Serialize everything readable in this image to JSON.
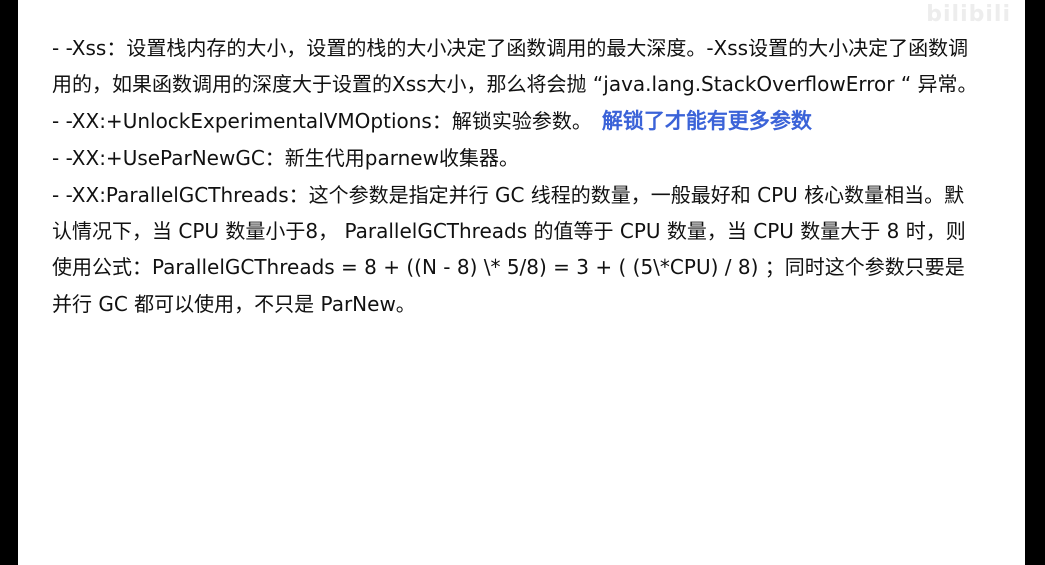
{
  "watermark": "bilibili",
  "paragraphs": [
    "- -Xss：设置栈内存的大小，设置的栈的大小决定了函数调用的最大深度。-Xss设置的大小决定了函数调用的，如果函数调用的深度大于设置的Xss大小，那么将会抛 “java.lang.StackOverflowError “ 异常。",
    "- -XX:+UnlockExperimentalVMOptions：解锁实验参数。",
    "- -XX:+UseParNewGC：新生代用parnew收集器。",
    "- -XX:ParallelGCThreads：这个参数是指定并行 GC 线程的数量，一般最好和 CPU 核心数量相当。默认情况下，当 CPU 数量小于8， ParallelGCThreads 的值等于 CPU 数量，当 CPU 数量大于 8 时，则使用公式：ParallelGCThreads = 8 + ((N - 8) \\* 5/8) = 3 + ( (5\\*CPU) / 8) ；同时这个参数只要是并行 GC 都可以使用，不只是 ParNew。"
  ],
  "annotation": {
    "text": "解锁了才能有更多参数",
    "color": "#3b63d8"
  }
}
